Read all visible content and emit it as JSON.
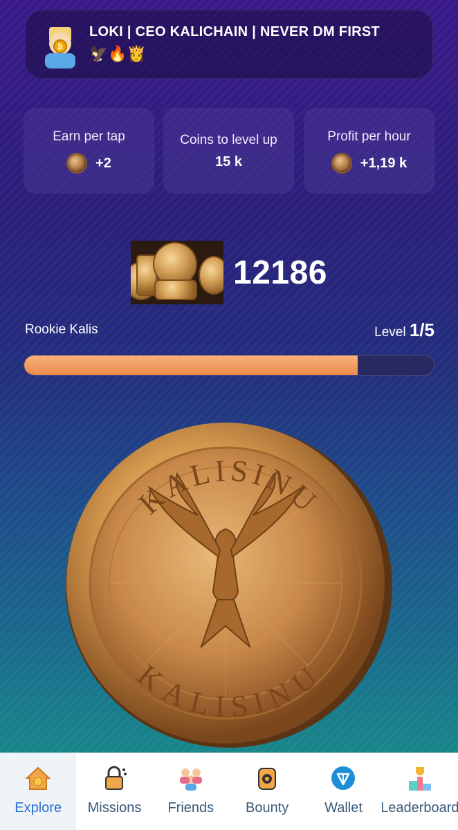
{
  "header": {
    "username": "LOKI | CEO KALICHAIN | NEVER DM FIRST",
    "emojis": "🦅🔥👸",
    "avatar_icon": "avatar-bitcoin-icon"
  },
  "stats": [
    {
      "label": "Earn per tap",
      "value": "+2"
    },
    {
      "label": "Coins to level up",
      "value": "15 k"
    },
    {
      "label": "Profit per hour",
      "value": "+1,19 k"
    }
  ],
  "balance": "12186",
  "rank": "Rookie Kalis",
  "level": {
    "label": "Level",
    "value": "1/5"
  },
  "progress": 0.815,
  "coin": {
    "top_text": "KALISINU",
    "bottom_text": "KALISINU"
  },
  "nav": [
    {
      "label": "Explore",
      "icon": "home-icon",
      "active": true
    },
    {
      "label": "Missions",
      "icon": "lock-icon",
      "active": false
    },
    {
      "label": "Friends",
      "icon": "friends-icon",
      "active": false
    },
    {
      "label": "Bounty",
      "icon": "bounty-icon",
      "active": false
    },
    {
      "label": "Wallet",
      "icon": "wallet-icon",
      "active": false
    },
    {
      "label": "Leaderboard",
      "icon": "leaderboard-icon",
      "active": false
    }
  ],
  "colors": {
    "accent": "#ec8a4c",
    "nav_active": "#2a6fd1"
  }
}
